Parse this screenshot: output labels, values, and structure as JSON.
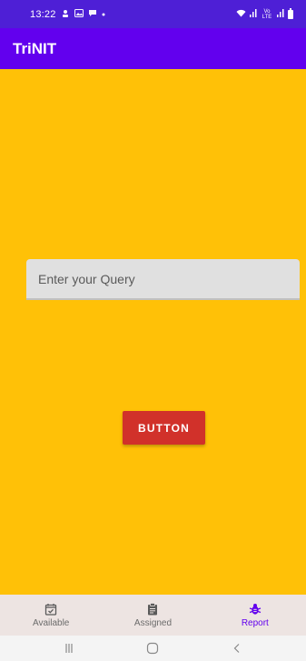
{
  "status_bar": {
    "time": "13:22",
    "left_icons": [
      "person-pin-icon",
      "image-icon",
      "message-icon",
      "dot-icon"
    ],
    "right_text": "Vo LTE"
  },
  "app_bar": {
    "title": "TriNIT"
  },
  "form": {
    "query_placeholder": "Enter your Query",
    "button_label": "BUTTON"
  },
  "bottom_nav": {
    "items": [
      {
        "label": "Available",
        "icon": "calendar-check-icon",
        "active": false
      },
      {
        "label": "Assigned",
        "icon": "clipboard-icon",
        "active": false
      },
      {
        "label": "Report",
        "icon": "bug-icon",
        "active": true
      }
    ]
  },
  "colors": {
    "status_bar": "#4e1fd6",
    "app_bar": "#6200ee",
    "background": "#ffc107",
    "button": "#d1312a",
    "input": "#e0e0e0",
    "bottom_nav": "#ede4e2",
    "active_tab": "#6200ee"
  }
}
